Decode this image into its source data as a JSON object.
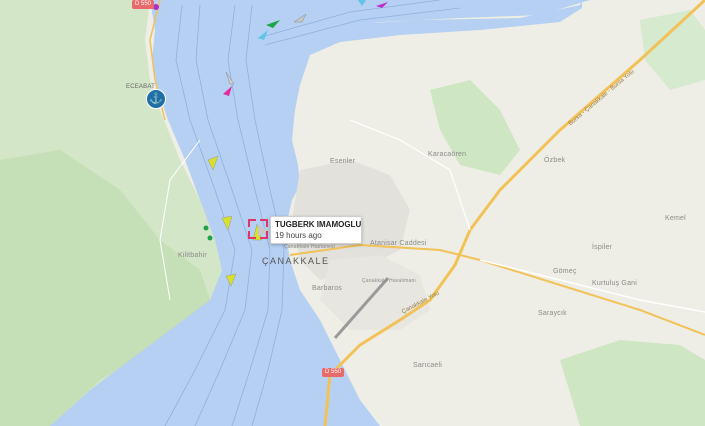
{
  "map": {
    "water_color": "#b5d0f2",
    "land_color": "#eeeee6",
    "green_color": "#cfe6c3",
    "road_color": "#f2c158"
  },
  "popup": {
    "vessel_name": "TUGBERK IMAMOGLU",
    "last_seen": "19 hours ago"
  },
  "labels": {
    "eceabat": "ECEABAT",
    "canakkale": "ÇANAKKALE",
    "kilitbahir": "Kilitbahir",
    "esenler": "Esenler",
    "karacaoren": "Karacaören",
    "ozbek": "Özbek",
    "atanisar": "Atanisar Caddesi",
    "kemel": "Kemel",
    "ispiler": "İspiler",
    "gomec": "Gömeç",
    "kurtuluş": "Kurtuluş Gani",
    "sarcayir": "Saraycık",
    "sarıcaeli": "Sarıcaeli",
    "barbaros": "Barbaros",
    "airport": "Çanakkale Havalimanı",
    "kepez": "Çanakkale Hastanesi",
    "road1": "Bursa - Çanakkale - Bursa Yolu",
    "road2": "Çanakkale Yolu",
    "shield_top": "D 550",
    "shield_bottom": "D 550"
  },
  "icons": {
    "anchor": "anchor-icon",
    "vessel": "vessel-arrow-icon",
    "target": "selection-marker-icon"
  }
}
